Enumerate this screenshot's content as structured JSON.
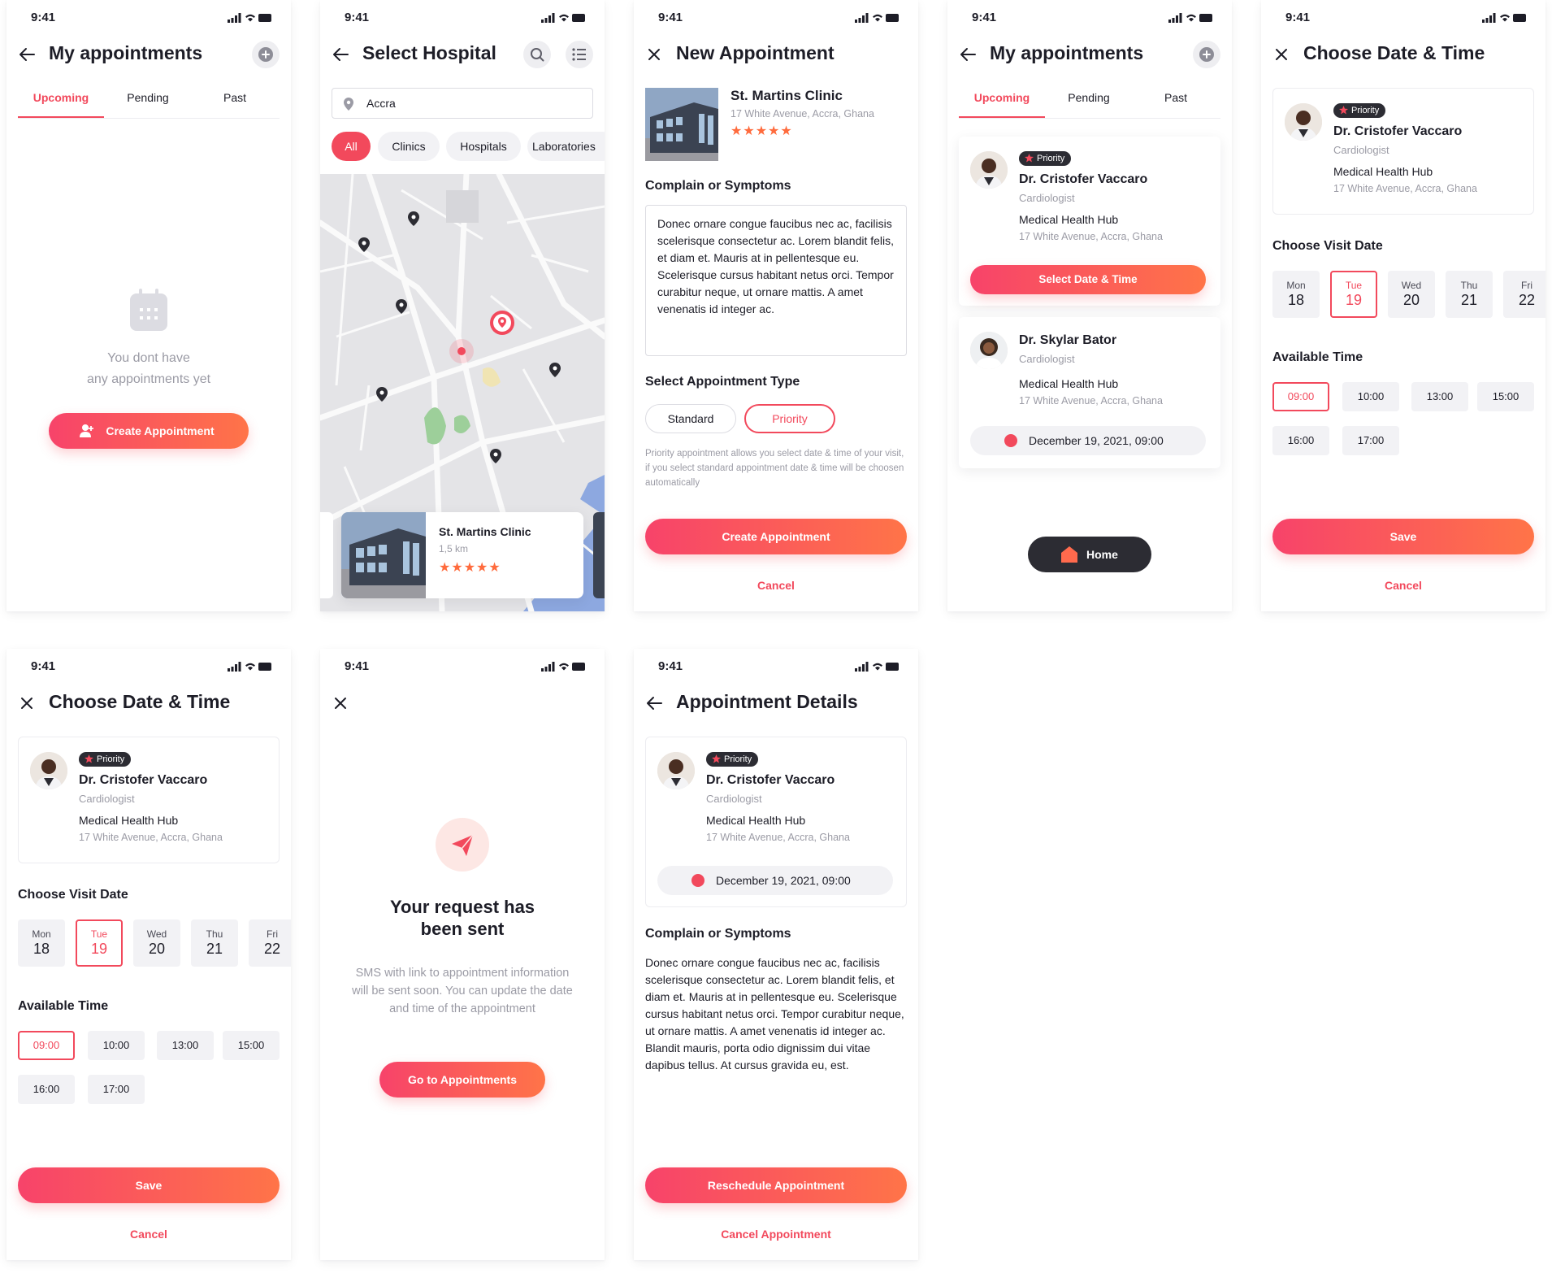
{
  "status_time": "9:41",
  "colors": {
    "accent": "#f2495c",
    "gradient_start": "#f7436a",
    "gradient_end": "#ff7448",
    "dark": "#2c2c33"
  },
  "doctor1": {
    "badge": "Priority",
    "name": "Dr. Cristofer Vaccaro",
    "specialty": "Cardiologist",
    "hospital": "Medical Health Hub",
    "address": "17 White Avenue, Accra, Ghana",
    "datetime": "December 19, 2021, 09:00"
  },
  "doctor2": {
    "name": "Dr. Skylar Bator",
    "specialty": "Cardiologist",
    "hospital": "Medical Health Hub",
    "address": "17 White Avenue, Accra, Ghana",
    "datetime": "December 19, 2021, 09:00"
  },
  "tabs": [
    "Upcoming",
    "Pending",
    "Past"
  ],
  "s1": {
    "title": "My appointments",
    "empty_line1": "You dont have",
    "empty_line2": "any appointments yet",
    "create_button": "Create Appointment"
  },
  "s2": {
    "title": "Select Hospital",
    "search_value": "Accra",
    "filters": [
      "All",
      "Clinics",
      "Hospitals",
      "Laboratories"
    ],
    "clinic_name": "St. Martins Clinic",
    "clinic_distance": "1,5 km",
    "rating": 5
  },
  "s3": {
    "title": "New Appointment",
    "clinic_name": "St. Martins Clinic",
    "clinic_address": "17 White Avenue, Accra, Ghana",
    "rating": 5,
    "symptoms_title": "Complain or Symptoms",
    "symptoms_text": "Donec ornare congue faucibus nec ac, facilisis scelerisque consectetur ac. Lorem blandit felis, et diam et. Mauris at in pellentesque eu. Scelerisque cursus habitant netus orci. Tempor curabitur neque, ut ornare mattis. A amet venenatis id integer ac.",
    "type_title": "Select Appointment Type",
    "type_standard": "Standard",
    "type_priority": "Priority",
    "type_note": "Priority appointment allows you select date & time of your visit, if you select standard appointment date & time will be choosen automatically",
    "create_button": "Create Appointment",
    "cancel": "Cancel"
  },
  "s4": {
    "title": "My appointments",
    "select_button": "Select Date & Time",
    "home_button": "Home"
  },
  "datetime_screen": {
    "title": "Choose Date & Time",
    "visit_date_title": "Choose Visit Date",
    "days": [
      {
        "name": "Mon",
        "num": "18"
      },
      {
        "name": "Tue",
        "num": "19"
      },
      {
        "name": "Wed",
        "num": "20"
      },
      {
        "name": "Thu",
        "num": "21"
      },
      {
        "name": "Fri",
        "num": "22"
      }
    ],
    "time_title": "Available Time",
    "times": [
      "09:00",
      "10:00",
      "13:00",
      "15:00",
      "16:00",
      "17:00"
    ],
    "save": "Save",
    "cancel": "Cancel"
  },
  "s7": {
    "heading_line1": "Your request has",
    "heading_line2": "been sent",
    "message": "SMS with link to appointment information will be sent soon. You can update the date and time of the appointment",
    "button": "Go to Appointments"
  },
  "s8": {
    "title": "Appointment Details",
    "symptoms_title": "Complain or Symptoms",
    "symptoms_text": "Donec ornare congue faucibus nec ac, facilisis scelerisque consectetur ac. Lorem blandit felis, et diam et. Mauris at in pellentesque eu. Scelerisque cursus habitant netus orci. Tempor curabitur neque, ut ornare mattis. A amet venenatis id integer ac. Blandit mauris, porta odio dignissim dui vitae dapibus tellus. At cursus gravida eu, est.",
    "reschedule_button": "Reschedule Appointment",
    "cancel_link": "Cancel Appointment"
  }
}
